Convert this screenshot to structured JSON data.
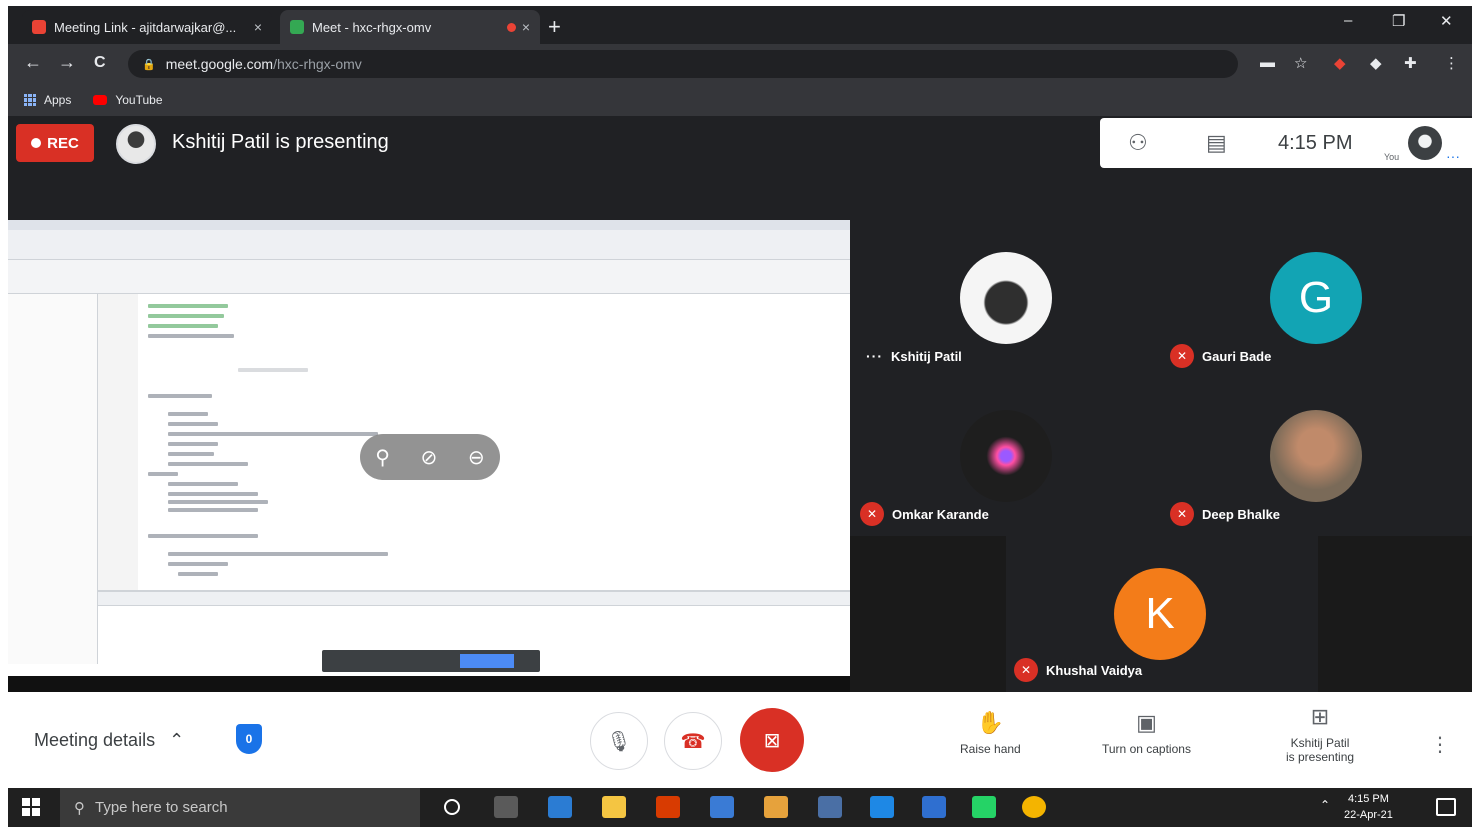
{
  "browser": {
    "tabs": [
      {
        "title": "Meeting Link - ajitdarwajkar@...",
        "close": "×",
        "active": false
      },
      {
        "title": "Meet - hxc-rhgx-omv",
        "close": "×",
        "active": true
      }
    ],
    "new_tab": "+",
    "window_controls": {
      "minimize": "–",
      "restore": "❐",
      "close": "✕"
    },
    "nav": {
      "back": "←",
      "forward": "→",
      "reload": "C"
    },
    "url": {
      "host": "meet.google.com",
      "path": "/hxc-rhgx-omv"
    },
    "bookmarks": [
      {
        "label": "Apps",
        "icon": "apps-grid-icon"
      },
      {
        "label": "YouTube",
        "icon": "youtube-icon"
      }
    ]
  },
  "meet": {
    "rec_label": "REC",
    "presenting_text": "Kshitij Patil is presenting",
    "time": "4:15 PM",
    "you_label": "You",
    "participants": [
      {
        "name": "Kshitij Patil",
        "avatar": "photo",
        "muted": false
      },
      {
        "name": "Gauri Bade",
        "initial": "G",
        "color": "#12a4b4",
        "muted": true
      },
      {
        "name": "Omkar Karande",
        "avatar": "logo",
        "muted": true
      },
      {
        "name": "Deep Bhalke",
        "avatar": "photo",
        "muted": true
      },
      {
        "name": "Khushal Vaidya",
        "initial": "K",
        "color": "#f37c19",
        "muted": true
      }
    ]
  },
  "controls": {
    "meeting_details": "Meeting details",
    "chevron": "⌃",
    "shield_letter": "0",
    "raise_hand": "Raise hand",
    "captions": "Turn on captions",
    "presenting_line1": "Kshitij Patil",
    "presenting_line2": "is presenting",
    "more": "⋮"
  },
  "taskbar": {
    "search_placeholder": "Type here to search",
    "time": "4:15 PM",
    "date": "22-Apr-21"
  },
  "colors": {
    "rec_red": "#d93025",
    "meet_dark": "#202124",
    "accent_blue": "#1a73e8"
  }
}
